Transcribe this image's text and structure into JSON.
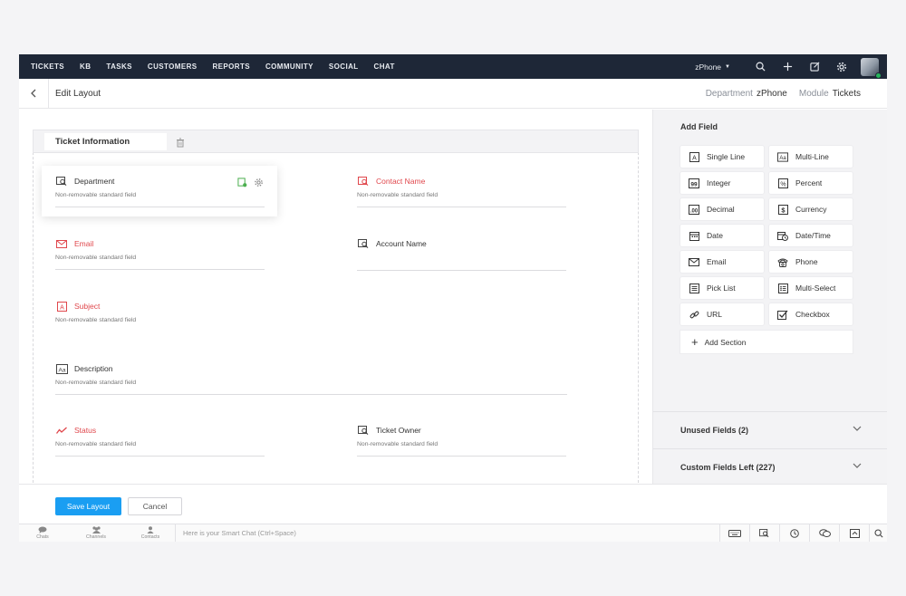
{
  "nav": {
    "items": [
      "TICKETS",
      "KB",
      "TASKS",
      "CUSTOMERS",
      "REPORTS",
      "COMMUNITY",
      "SOCIAL",
      "CHAT"
    ],
    "channel_selector": "zPhone",
    "icons": [
      "search-icon",
      "plus-icon",
      "compose-icon",
      "gear-icon",
      "user-avatar"
    ]
  },
  "subheader": {
    "title": "Edit Layout",
    "department_label": "Department",
    "department_value": "zPhone",
    "module_label": "Module",
    "module_value": "Tickets"
  },
  "section": {
    "title": "Ticket Information"
  },
  "fields": [
    {
      "name": "Department",
      "sub": "Non-removable standard field",
      "icon": "lookup-icon",
      "required": false
    },
    {
      "name": "Contact Name",
      "sub": "Non-removable standard field",
      "icon": "lookup-icon",
      "required": true
    },
    {
      "name": "Email",
      "sub": "Non-removable standard field",
      "icon": "email-icon",
      "required": true
    },
    {
      "name": "Account Name",
      "sub": "",
      "icon": "lookup-icon",
      "required": false
    },
    {
      "name": "Subject",
      "sub": "Non-removable standard field",
      "icon": "single-line-icon",
      "required": true
    },
    {
      "name": "Description",
      "sub": "Non-removable standard field",
      "icon": "multi-line-icon",
      "required": false
    },
    {
      "name": "Status",
      "sub": "Non-removable standard field",
      "icon": "status-icon",
      "required": true
    },
    {
      "name": "Ticket Owner",
      "sub": "Non-removable standard field",
      "icon": "lookup-icon",
      "required": false
    }
  ],
  "add_field": {
    "title": "Add Field",
    "types": [
      {
        "label": "Single Line",
        "icon": "single-line-icon"
      },
      {
        "label": "Multi-Line",
        "icon": "multi-line-icon"
      },
      {
        "label": "Integer",
        "icon": "integer-icon"
      },
      {
        "label": "Percent",
        "icon": "percent-icon"
      },
      {
        "label": "Decimal",
        "icon": "decimal-icon"
      },
      {
        "label": "Currency",
        "icon": "currency-icon"
      },
      {
        "label": "Date",
        "icon": "date-icon"
      },
      {
        "label": "Date/Time",
        "icon": "datetime-icon"
      },
      {
        "label": "Email",
        "icon": "email-icon"
      },
      {
        "label": "Phone",
        "icon": "phone-icon"
      },
      {
        "label": "Pick List",
        "icon": "picklist-icon"
      },
      {
        "label": "Multi-Select",
        "icon": "multiselect-icon"
      },
      {
        "label": "URL",
        "icon": "link-icon"
      },
      {
        "label": "Checkbox",
        "icon": "checkbox-icon"
      }
    ],
    "add_section": "Add Section"
  },
  "accordions": {
    "unused": "Unused Fields (2)",
    "custom_left": "Custom Fields Left (227)"
  },
  "footer": {
    "save": "Save Layout",
    "cancel": "Cancel"
  },
  "bottombar": {
    "chats": "Chats",
    "channels": "Channels",
    "contacts": "Contacts",
    "smartchat_placeholder": "Here is your Smart Chat (Ctrl+Space)"
  },
  "colors": {
    "nav_bg": "#1e2737",
    "primary": "#1a9ef2",
    "required_red": "#e0474c",
    "panel_bg": "#f3f3f5"
  }
}
